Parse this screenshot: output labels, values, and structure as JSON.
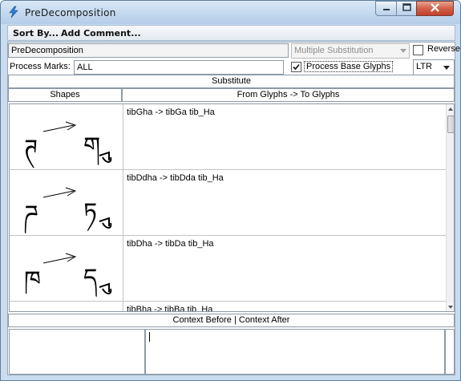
{
  "window": {
    "title": "PreDecomposition",
    "controls": {
      "minimize": "minimize-icon",
      "maximize": "maximize-icon",
      "close": "close-icon"
    }
  },
  "menu": {
    "sort_by": "Sort By...",
    "add_comment": "Add Comment..."
  },
  "lookup": {
    "name": "PreDecomposition",
    "type": "Multiple Substitution",
    "reverse_label": "Reverse",
    "reverse_checked": false
  },
  "process_marks": {
    "label": "Process Marks:",
    "value": "ALL",
    "process_base_glyphs_label": "Process Base Glyphs",
    "process_base_glyphs_checked": true,
    "direction": "LTR"
  },
  "table": {
    "title": "Substitute",
    "col_shapes": "Shapes",
    "col_glyphs": "From Glyphs -> To Glyphs",
    "rows": [
      {
        "text": "tibGha -> tibGa tib_Ha",
        "from_glyph": "ཊ",
        "to_glyph": "ག"
      },
      {
        "text": "tibDdha -> tibDda tib_Ha",
        "from_glyph": "ཌ",
        "to_glyph": "ཏ"
      },
      {
        "text": "tibDha -> tibDa tib_Ha",
        "from_glyph": "ཁ",
        "to_glyph": "ད"
      },
      {
        "text": "tibBha -> tibBa tib_Ha",
        "from_glyph": "",
        "to_glyph": ""
      }
    ]
  },
  "context": {
    "title": "Context Before | Context After",
    "before": "",
    "after": ""
  }
}
